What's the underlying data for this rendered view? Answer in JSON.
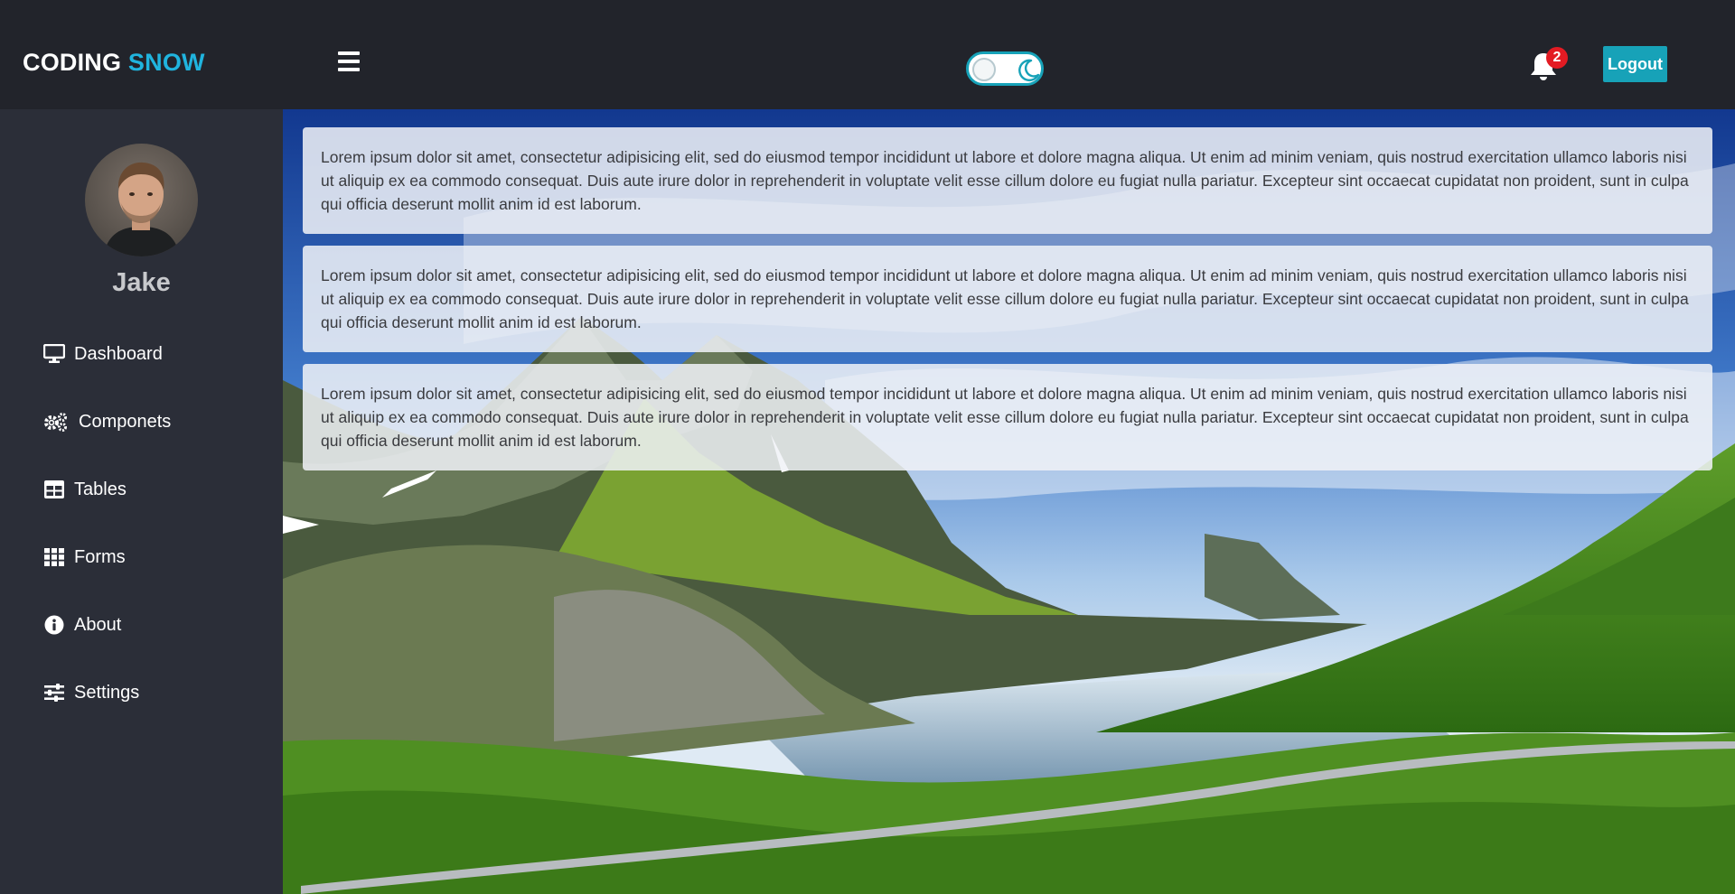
{
  "brand": {
    "part1": "CODING",
    "part2": "SNOW"
  },
  "header": {
    "notification_count": "2",
    "logout_label": "Logout",
    "theme_toggle": "dark"
  },
  "user": {
    "name": "Jake"
  },
  "sidebar": {
    "items": [
      {
        "label": "Dashboard",
        "icon": "monitor-icon"
      },
      {
        "label": "Componets",
        "icon": "cogs-icon"
      },
      {
        "label": "Tables",
        "icon": "table-icon"
      },
      {
        "label": "Forms",
        "icon": "grid-icon"
      },
      {
        "label": "About",
        "icon": "info-icon"
      },
      {
        "label": "Settings",
        "icon": "sliders-icon"
      }
    ]
  },
  "cards": [
    {
      "text": "Lorem ipsum dolor sit amet, consectetur adipisicing elit, sed do eiusmod tempor incididunt ut labore et dolore magna aliqua. Ut enim ad minim veniam, quis nostrud exercitation ullamco laboris nisi ut aliquip ex ea commodo consequat. Duis aute irure dolor in reprehenderit in voluptate velit esse cillum dolore eu fugiat nulla pariatur. Excepteur sint occaecat cupidatat non proident, sunt in culpa qui officia deserunt mollit anim id est laborum."
    },
    {
      "text": "Lorem ipsum dolor sit amet, consectetur adipisicing elit, sed do eiusmod tempor incididunt ut labore et dolore magna aliqua. Ut enim ad minim veniam, quis nostrud exercitation ullamco laboris nisi ut aliquip ex ea commodo consequat. Duis aute irure dolor in reprehenderit in voluptate velit esse cillum dolore eu fugiat nulla pariatur. Excepteur sint occaecat cupidatat non proident, sunt in culpa qui officia deserunt mollit anim id est laborum."
    },
    {
      "text": "Lorem ipsum dolor sit amet, consectetur adipisicing elit, sed do eiusmod tempor incididunt ut labore et dolore magna aliqua. Ut enim ad minim veniam, quis nostrud exercitation ullamco laboris nisi ut aliquip ex ea commodo consequat. Duis aute irure dolor in reprehenderit in voluptate velit esse cillum dolore eu fugiat nulla pariatur. Excepteur sint occaecat cupidatat non proident, sunt in culpa qui officia deserunt mollit anim id est laborum."
    }
  ],
  "colors": {
    "header_bg": "#22242b",
    "sidebar_bg": "#2b2e38",
    "accent": "#17a2b8",
    "brand_accent": "#20b4de",
    "badge": "#e31b23"
  }
}
